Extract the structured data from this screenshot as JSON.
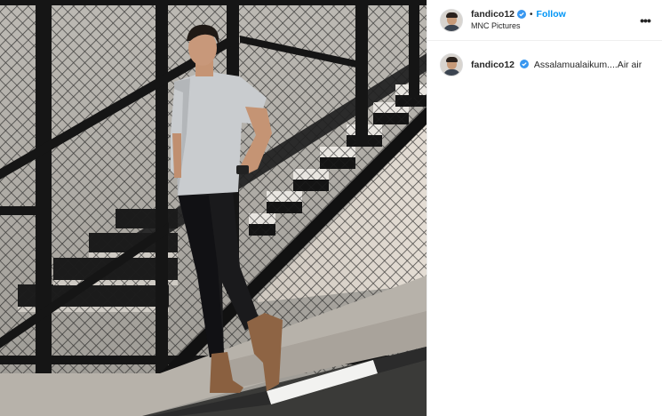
{
  "post": {
    "username": "fandico12",
    "location": "MNC Pictures",
    "follow_label": "Follow",
    "separator": "•",
    "more_label": "•••",
    "caption": "Assalamualaikum....Air air"
  },
  "photo": {
    "description_icon": "post-photo"
  },
  "colors": {
    "follow": "#0095f6",
    "verified": "#3897f0",
    "text": "#262626"
  }
}
